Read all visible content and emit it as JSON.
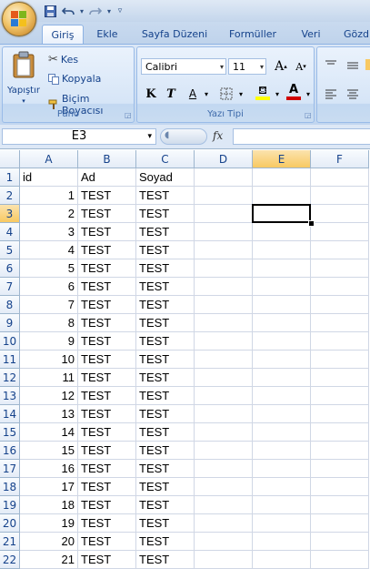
{
  "quick_access": {
    "save_icon": "save-icon",
    "undo_icon": "undo-icon",
    "redo_icon": "redo-icon"
  },
  "tabs": [
    "Giriş",
    "Ekle",
    "Sayfa Düzeni",
    "Formüller",
    "Veri",
    "Gözd"
  ],
  "ribbon": {
    "pano": {
      "label": "Pano",
      "paste_label": "Yapıştır",
      "cut_label": "Kes",
      "copy_label": "Kopyala",
      "format_painter_label": "Biçim Boyacısı"
    },
    "font": {
      "label": "Yazı Tipi",
      "font_name": "Calibri",
      "font_size": "11",
      "bold": "K",
      "italic": "T",
      "underline": "A",
      "grow": "A",
      "shrink": "A",
      "font_color_letter": "A"
    },
    "colors": {
      "font_color": "#d00000",
      "fill_color": "#ffff00",
      "accent": "#f8c962"
    }
  },
  "formula_bar": {
    "name_box": "E3",
    "fx_label": "fx",
    "formula": ""
  },
  "columns": [
    "A",
    "B",
    "C",
    "D",
    "E",
    "F"
  ],
  "active_cell": {
    "column": "E",
    "row": 3
  },
  "rows": [
    {
      "n": "1",
      "a": "id",
      "b": "Ad",
      "c": "Soyad"
    },
    {
      "n": "2",
      "a": "1",
      "b": "TEST",
      "c": "TEST"
    },
    {
      "n": "3",
      "a": "2",
      "b": "TEST",
      "c": "TEST"
    },
    {
      "n": "4",
      "a": "3",
      "b": "TEST",
      "c": "TEST"
    },
    {
      "n": "5",
      "a": "4",
      "b": "TEST",
      "c": "TEST"
    },
    {
      "n": "6",
      "a": "5",
      "b": "TEST",
      "c": "TEST"
    },
    {
      "n": "7",
      "a": "6",
      "b": "TEST",
      "c": "TEST"
    },
    {
      "n": "8",
      "a": "7",
      "b": "TEST",
      "c": "TEST"
    },
    {
      "n": "9",
      "a": "8",
      "b": "TEST",
      "c": "TEST"
    },
    {
      "n": "10",
      "a": "9",
      "b": "TEST",
      "c": "TEST"
    },
    {
      "n": "11",
      "a": "10",
      "b": "TEST",
      "c": "TEST"
    },
    {
      "n": "12",
      "a": "11",
      "b": "TEST",
      "c": "TEST"
    },
    {
      "n": "13",
      "a": "12",
      "b": "TEST",
      "c": "TEST"
    },
    {
      "n": "14",
      "a": "13",
      "b": "TEST",
      "c": "TEST"
    },
    {
      "n": "15",
      "a": "14",
      "b": "TEST",
      "c": "TEST"
    },
    {
      "n": "16",
      "a": "15",
      "b": "TEST",
      "c": "TEST"
    },
    {
      "n": "17",
      "a": "16",
      "b": "TEST",
      "c": "TEST"
    },
    {
      "n": "18",
      "a": "17",
      "b": "TEST",
      "c": "TEST"
    },
    {
      "n": "19",
      "a": "18",
      "b": "TEST",
      "c": "TEST"
    },
    {
      "n": "20",
      "a": "19",
      "b": "TEST",
      "c": "TEST"
    },
    {
      "n": "21",
      "a": "20",
      "b": "TEST",
      "c": "TEST"
    },
    {
      "n": "22",
      "a": "21",
      "b": "TEST",
      "c": "TEST"
    }
  ]
}
